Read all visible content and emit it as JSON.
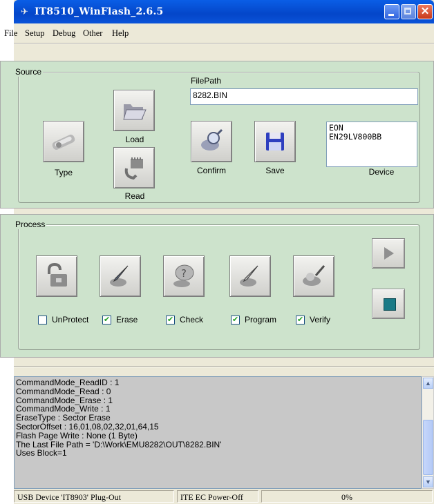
{
  "window": {
    "title": "IT8510_WinFlash_2.6.5"
  },
  "menu": [
    "File",
    "Setup",
    "Debug",
    "Other",
    "Help"
  ],
  "source": {
    "group_label": "Source",
    "filepath_label": "FilePath",
    "filepath_value": "8282.BIN",
    "buttons": {
      "type": "Type",
      "load": "Load",
      "read": "Read",
      "confirm": "Confirm",
      "save": "Save"
    },
    "device_lines": [
      "EON",
      "EN29LV800BB"
    ],
    "device_label": "Device"
  },
  "process": {
    "group_label": "Process",
    "checks": [
      {
        "label": "UnProtect",
        "checked": false
      },
      {
        "label": "Erase",
        "checked": true
      },
      {
        "label": "Check",
        "checked": true
      },
      {
        "label": "Program",
        "checked": true
      },
      {
        "label": "Verify",
        "checked": true
      }
    ]
  },
  "log": {
    "lines": [
      "CommandMode_ReadID : 1",
      "CommandMode_Read : 0",
      "CommandMode_Erase : 1",
      "CommandMode_Write : 1",
      "EraseType : Sector Erase",
      "SectorOffset : 16,01,08,02,32,01,64,15",
      "Flash Page Write : None (1 Byte)",
      "The Last File Path = 'D:\\Work\\EMU8282\\OUT\\8282.BIN'",
      "Uses Block=1"
    ]
  },
  "status": {
    "usb": "USB Device 'IT8903' Plug-Out",
    "ec": "ITE EC Power-Off",
    "progress": "0%"
  },
  "colors": {
    "panel_green": "#cde3cc",
    "titlebar_blue": "#0446c9",
    "log_gray": "#c8c8c8"
  }
}
